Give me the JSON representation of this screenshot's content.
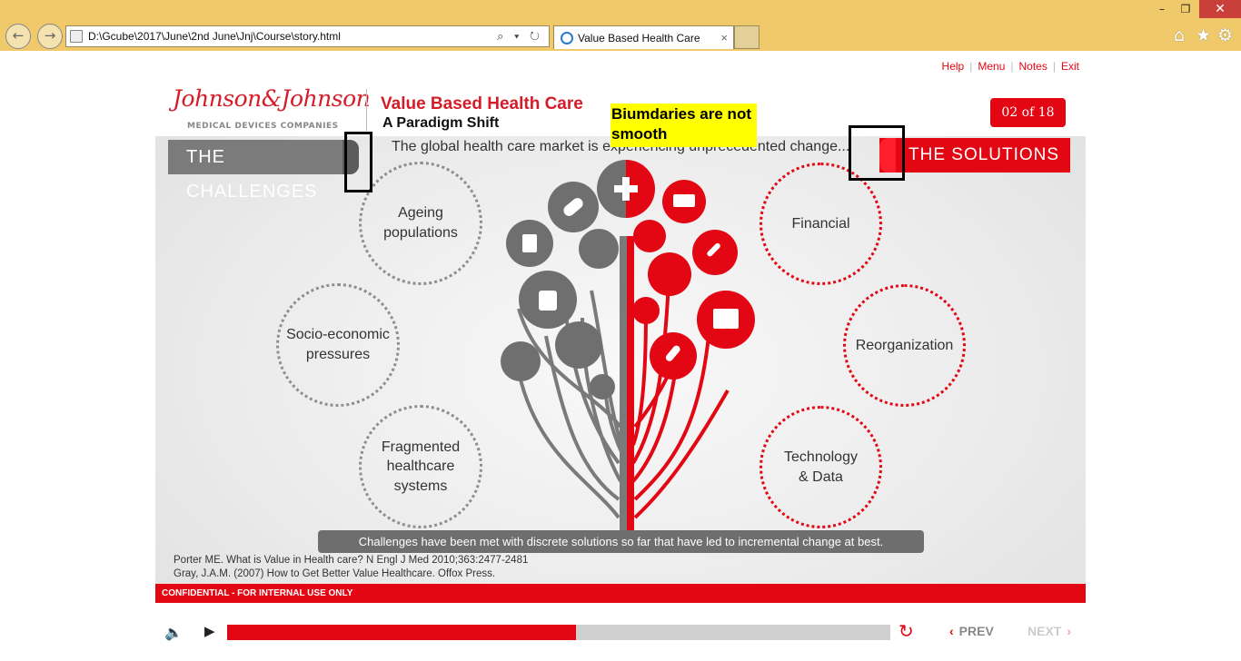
{
  "browser": {
    "address": "D:\\Gcube\\2017\\June\\2nd June\\Jnj\\Course\\story.html",
    "address_tools": "⌕ ▾ ↻",
    "tab_title": "Value Based Health Care",
    "tab_close": "×",
    "back": "←",
    "forward": "→",
    "minimize": "–",
    "restore": "❐",
    "close": "✕",
    "home": "⌂",
    "favorites": "★",
    "settings": "⚙"
  },
  "top_nav": {
    "help": "Help",
    "menu": "Menu",
    "notes": "Notes",
    "exit": "Exit",
    "sep": "|"
  },
  "header": {
    "logo_script": "Johnson&Johnson",
    "logo_sub": "MEDICAL DEVICES COMPANIES",
    "title": "Value Based Health Care",
    "subtitle": "A Paradigm Shift",
    "page_counter": "02 of 18",
    "tagline": "The global health care market is experiencing unprecedented change..."
  },
  "bands": {
    "challenges": "THE CHALLENGES",
    "solutions": "THE SOLUTIONS"
  },
  "challenges": [
    {
      "line1": "Ageing",
      "line2": "populations",
      "line3": ""
    },
    {
      "line1": "Socio-economic",
      "line2": "pressures",
      "line3": ""
    },
    {
      "line1": "Fragmented",
      "line2": "healthcare",
      "line3": "systems"
    }
  ],
  "solutions": [
    {
      "line1": "Financial",
      "line2": ""
    },
    {
      "line1": "Reorganization",
      "line2": ""
    },
    {
      "line1": "Technology",
      "line2": "& Data"
    }
  ],
  "caption": "Challenges have been met with discrete solutions so far that have led to incremental change at best.",
  "references": [
    "Porter ME. What is Value in Health care? N Engl J Med 2010;363:2477-2481",
    "Gray, J.A.M. (2007) How to Get Better Value Healthcare. Offox Press."
  ],
  "confidential": "CONFIDENTIAL - FOR INTERNAL USE ONLY",
  "annotation": {
    "note": "Biumdaries are not smooth"
  },
  "player": {
    "volume_icon": "🔈",
    "play_icon": "▶",
    "progress": 0.526,
    "replay_icon": "↻",
    "prev": "PREV",
    "next": "NEXT",
    "prev_chevron": "‹",
    "next_chevron": "›"
  },
  "colors": {
    "brand_red": "#e30613",
    "gray": "#7b7b7b"
  }
}
